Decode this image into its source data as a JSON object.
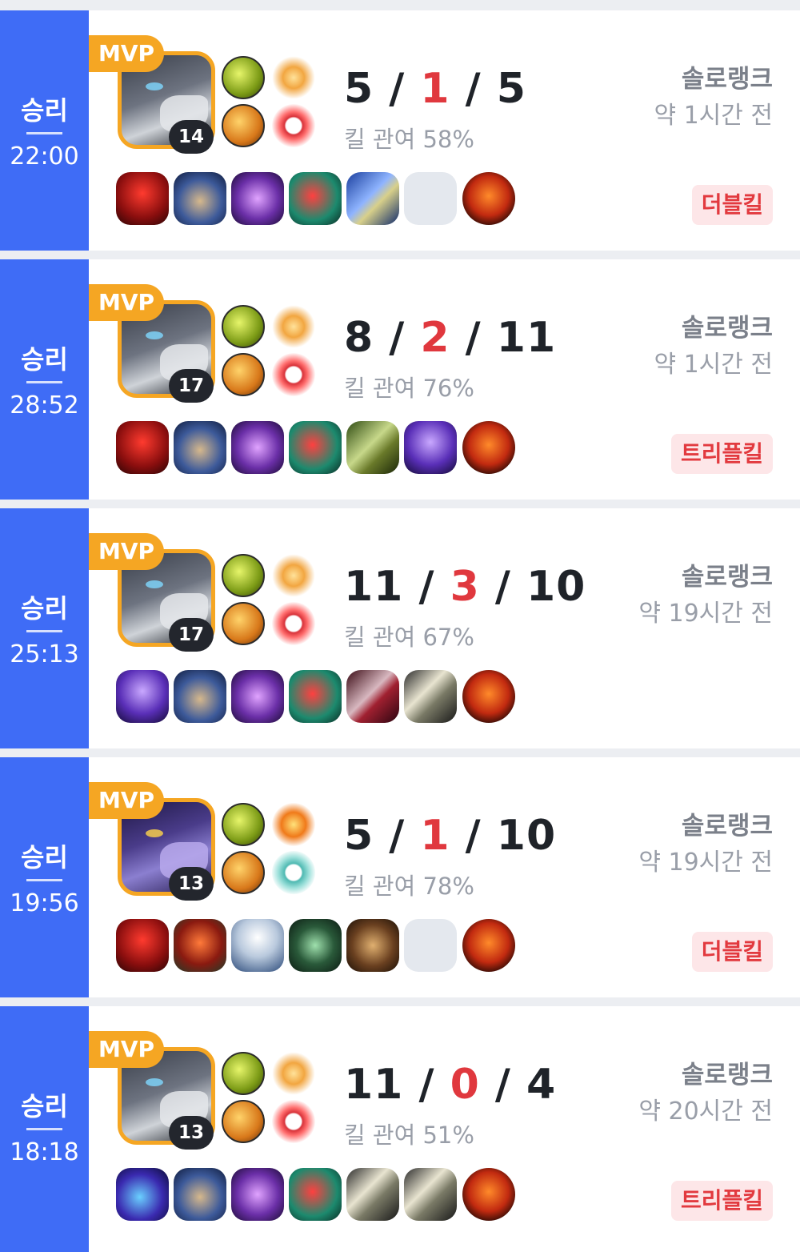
{
  "colors": {
    "win": "#3f6cf6",
    "mvp": "#f5a623",
    "death": "#e0383e",
    "badge_bg": "#fde6e8",
    "badge_text": "#e23a3f"
  },
  "matches": [
    {
      "result": "승리",
      "duration": "22:00",
      "mvp": "MVP",
      "level": "14",
      "kills": "5",
      "deaths": "1",
      "assists": "5",
      "kill_participation": "킬 관여 58%",
      "queue": "솔로랭크",
      "time_ago": "약 1시간 전",
      "badge": "더블킬",
      "spells": [
        "flash-icon",
        "ignite-icon"
      ],
      "runes": [
        "fleet-footwork-icon",
        "domination-icon"
      ]
    },
    {
      "result": "승리",
      "duration": "28:52",
      "mvp": "MVP",
      "level": "17",
      "kills": "8",
      "deaths": "2",
      "assists": "11",
      "kill_participation": "킬 관여 76%",
      "queue": "솔로랭크",
      "time_ago": "약 1시간 전",
      "badge": "트리플킬",
      "spells": [
        "flash-icon",
        "ignite-icon"
      ],
      "runes": [
        "fleet-footwork-icon",
        "domination-icon"
      ]
    },
    {
      "result": "승리",
      "duration": "25:13",
      "mvp": "MVP",
      "level": "17",
      "kills": "11",
      "deaths": "3",
      "assists": "10",
      "kill_participation": "킬 관여 67%",
      "queue": "솔로랭크",
      "time_ago": "약 19시간 전",
      "badge": "",
      "spells": [
        "flash-icon",
        "ignite-icon"
      ],
      "runes": [
        "fleet-footwork-icon",
        "domination-icon"
      ]
    },
    {
      "result": "승리",
      "duration": "19:56",
      "mvp": "MVP",
      "level": "13",
      "kills": "5",
      "deaths": "1",
      "assists": "10",
      "kill_participation": "킬 관여 78%",
      "queue": "솔로랭크",
      "time_ago": "약 19시간 전",
      "badge": "더블킬",
      "spells": [
        "flash-icon",
        "ignite-icon"
      ],
      "runes": [
        "electrocute-icon",
        "resolve-icon"
      ]
    },
    {
      "result": "승리",
      "duration": "18:18",
      "mvp": "MVP",
      "level": "13",
      "kills": "11",
      "deaths": "0",
      "assists": "4",
      "kill_participation": "킬 관여 51%",
      "queue": "솔로랭크",
      "time_ago": "약 20시간 전",
      "badge": "트리플킬",
      "spells": [
        "flash-icon",
        "ignite-icon"
      ],
      "runes": [
        "fleet-footwork-icon",
        "domination-icon"
      ]
    }
  ]
}
